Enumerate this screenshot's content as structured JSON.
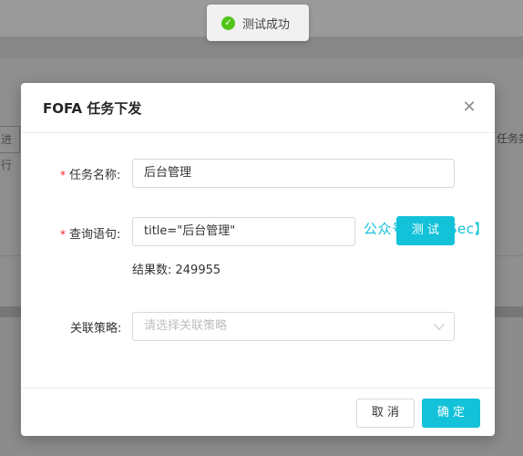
{
  "toast": {
    "text": "测试成功",
    "icon": "check-circle-icon",
    "color": "#52c41a"
  },
  "background": {
    "left_fragment": "进行",
    "right_fragment": "任务类"
  },
  "modal": {
    "title": "FOFA 任务下发",
    "fields": {
      "task_name": {
        "label": "任务名称:",
        "required": true,
        "value": "后台管理"
      },
      "query": {
        "label": "查询语句:",
        "required": true,
        "value": "title=\"后台管理\"",
        "test_button": "测 试",
        "result": "结果数: 249955"
      },
      "policy": {
        "label": "关联策略:",
        "required": false,
        "placeholder": "请选择关联策略"
      }
    },
    "footer": {
      "cancel": "取 消",
      "ok": "确 定"
    },
    "accent_color": "#13c2d8"
  },
  "watermark": "公众号：网安Sec】"
}
